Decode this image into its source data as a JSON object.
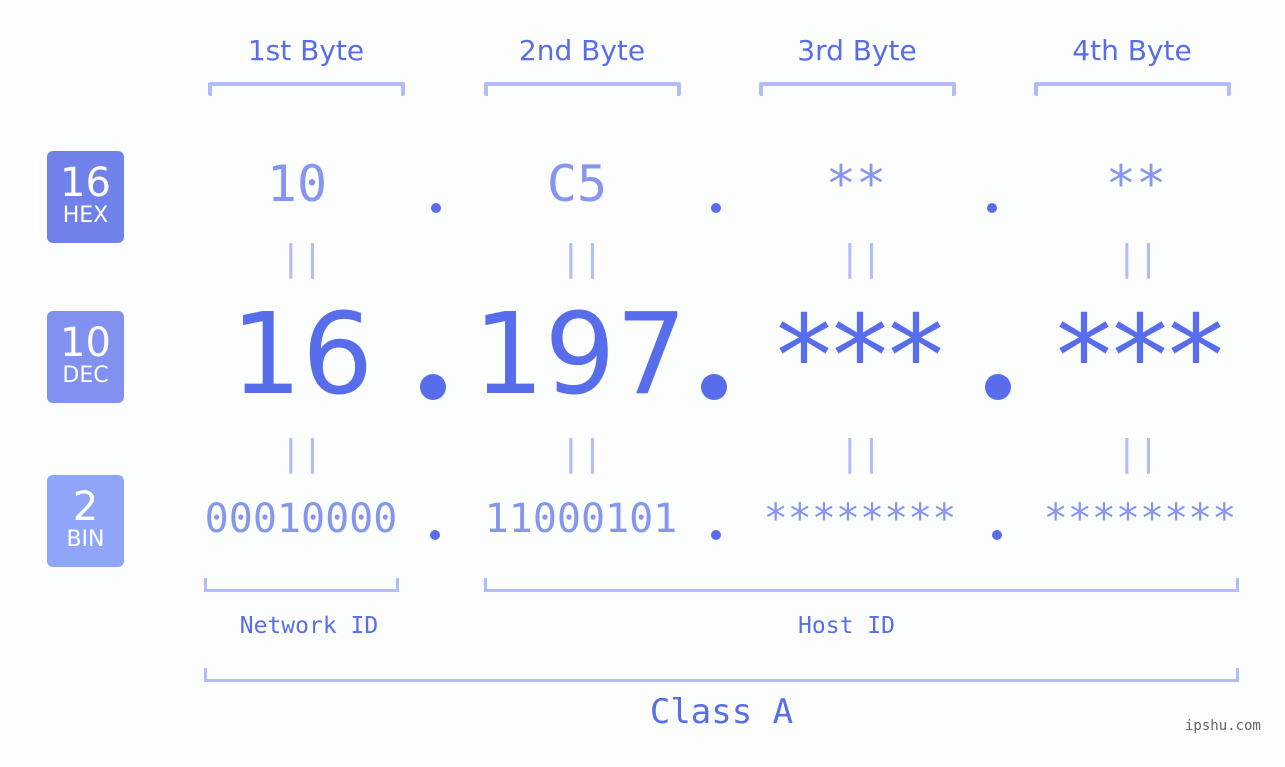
{
  "byte_headers": [
    "1st Byte",
    "2nd Byte",
    "3rd Byte",
    "4th Byte"
  ],
  "badges": {
    "hex": {
      "number": "16",
      "label": "HEX",
      "color": "#7081ea"
    },
    "dec": {
      "number": "10",
      "label": "DEC",
      "color": "#8291f0"
    },
    "bin": {
      "number": "2",
      "label": "BIN",
      "color": "#8fa5f9"
    }
  },
  "hex": [
    "10",
    "C5",
    "**",
    "**"
  ],
  "dec": [
    "16",
    "197",
    "***",
    "***"
  ],
  "bin": [
    "00010000",
    "11000101",
    "********",
    "********"
  ],
  "equals_sign": "||",
  "network_id_label": "Network ID",
  "host_id_label": "Host ID",
  "class_label": "Class A",
  "watermark": "ipshu.com",
  "colors": {
    "accent": "#586deb",
    "light_accent": "#8696ee",
    "bracket": "#b3bcf7",
    "background": "#fcfdfd"
  }
}
